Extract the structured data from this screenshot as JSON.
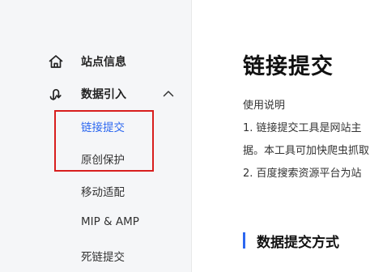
{
  "sidebar": {
    "items": [
      {
        "label": "站点信息",
        "icon": "home-icon"
      },
      {
        "label": "数据引入",
        "icon": "data-import-icon",
        "expand_icon": "chevron-up-icon"
      }
    ],
    "sub_items": [
      {
        "label": "链接提交",
        "active": true
      },
      {
        "label": "原创保护",
        "active": false
      },
      {
        "label": "移动适配",
        "active": false
      },
      {
        "label": "MIP & AMP",
        "active": false
      },
      {
        "label": "死链提交",
        "active": false
      }
    ]
  },
  "main": {
    "title": "链接提交",
    "desc_head": "使用说明",
    "desc_lines": [
      "1. 链接提交工具是网站主",
      "据。本工具可加快爬虫抓取",
      "2. 百度搜索资源平台为站"
    ],
    "section_title": "数据提交方式"
  },
  "colors": {
    "accent": "#2c67f0",
    "highlight": "#d81e1e",
    "sidebar_bg": "#f5f6f8"
  }
}
